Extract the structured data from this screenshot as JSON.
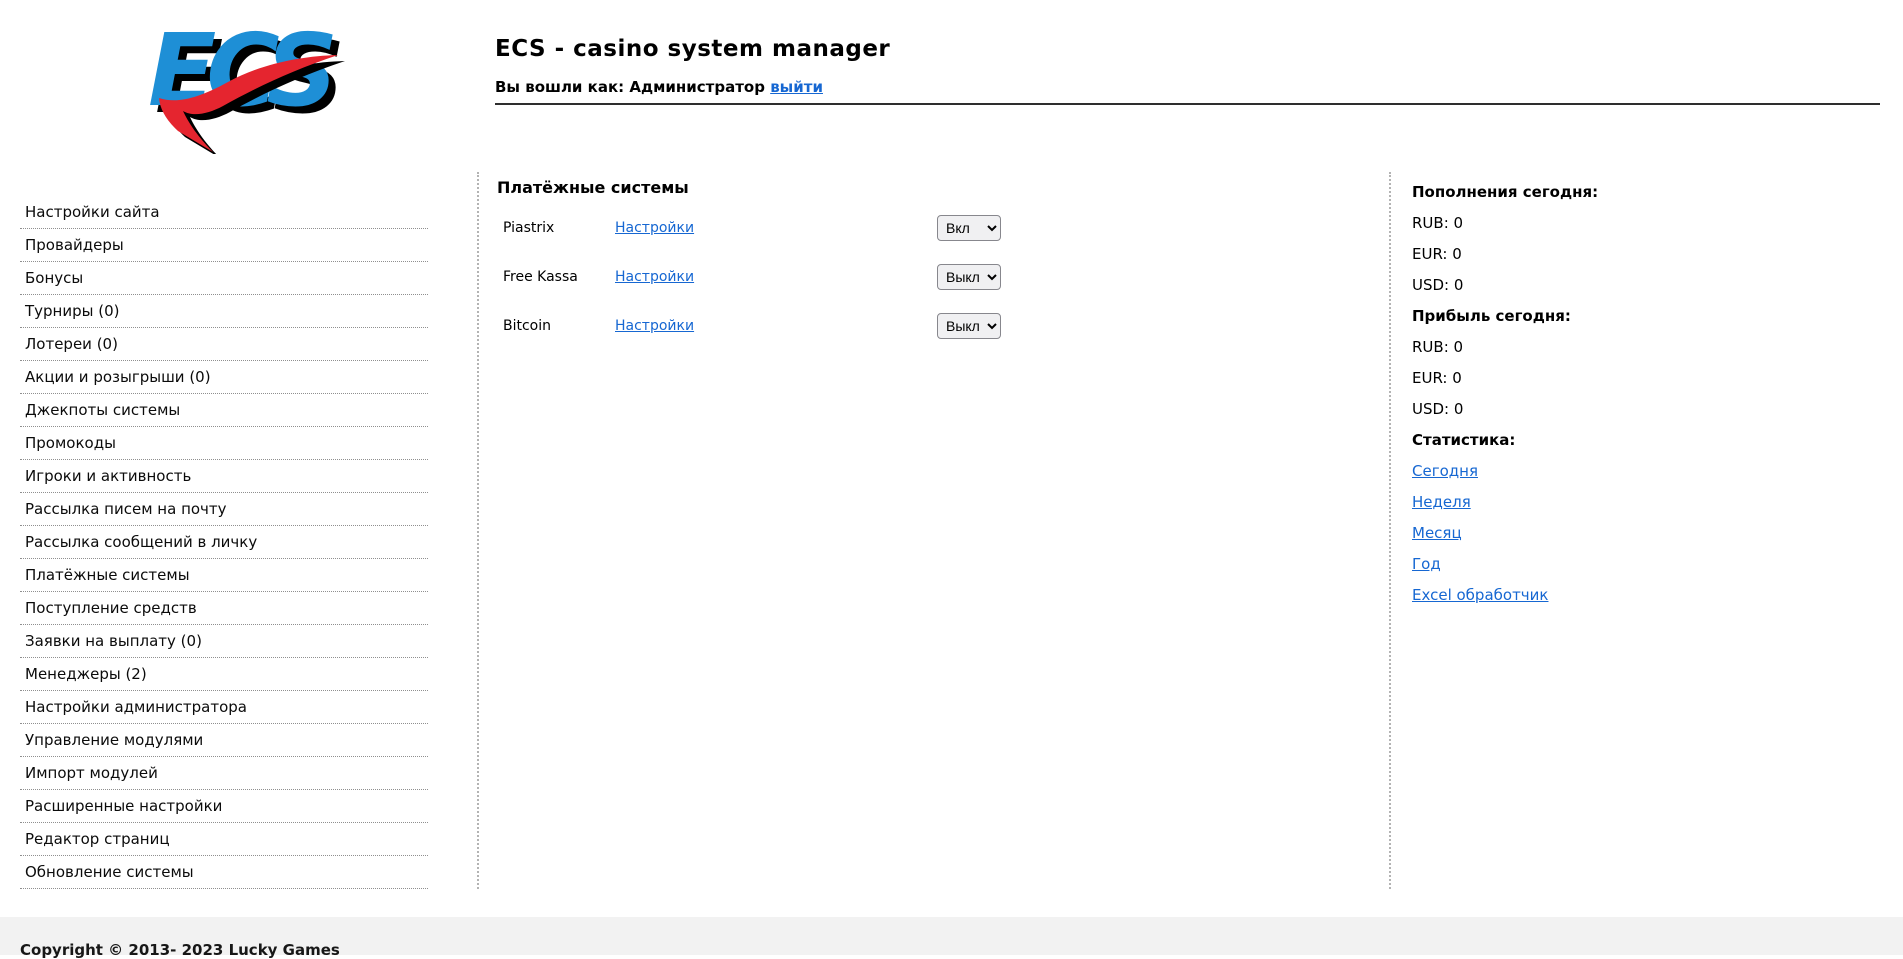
{
  "header": {
    "logo_text": "ECS",
    "title": "ECS - casino system manager",
    "login_prefix": "Вы вошли как:",
    "login_user": "Администратор",
    "logout_label": "выйти"
  },
  "sidebar": {
    "items": [
      "Настройки сайта",
      "Провайдеры",
      "Бонусы",
      "Турниры (0)",
      "Лотереи (0)",
      "Акции и розыгрыши (0)",
      "Джекпоты системы",
      "Промокоды",
      "Игроки и активность",
      "Рассылка писем на почту",
      "Рассылка сообщений в личку",
      "Платёжные системы",
      "Поступление средств",
      "Заявки на выплату (0)",
      "Менеджеры (2)",
      "Настройки администратора",
      "Управление модулями",
      "Импорт модулей",
      "Расширенные настройки",
      "Редактор страниц",
      "Обновление системы"
    ]
  },
  "main": {
    "title": "Платёжные системы",
    "status_options": [
      "Вкл",
      "Выкл"
    ],
    "rows": [
      {
        "name": "Piastrix",
        "settings_label": "Настройки",
        "status": "Вкл"
      },
      {
        "name": "Free Kassa",
        "settings_label": "Настройки",
        "status": "Выкл"
      },
      {
        "name": "Bitcoin",
        "settings_label": "Настройки",
        "status": "Выкл"
      }
    ]
  },
  "stats_panel": {
    "deposits_title": "Пополнения сегодня:",
    "deposits": [
      "RUB: 0",
      "EUR: 0",
      "USD: 0"
    ],
    "profit_title": "Прибыль сегодня:",
    "profit": [
      "RUB: 0",
      "EUR: 0",
      "USD: 0"
    ],
    "stats_title": "Статистика:",
    "links": [
      "Сегодня",
      "Неделя",
      "Месяц",
      "Год",
      "Excel обработчик"
    ]
  },
  "footer": {
    "copyright": "Copyright © 2013- 2023 Lucky Games"
  },
  "colors": {
    "link_blue": "#1667d2",
    "logo_blue": "#1e8fd6",
    "logo_red": "#e5252f",
    "footer_background": "#f2f2f2"
  }
}
